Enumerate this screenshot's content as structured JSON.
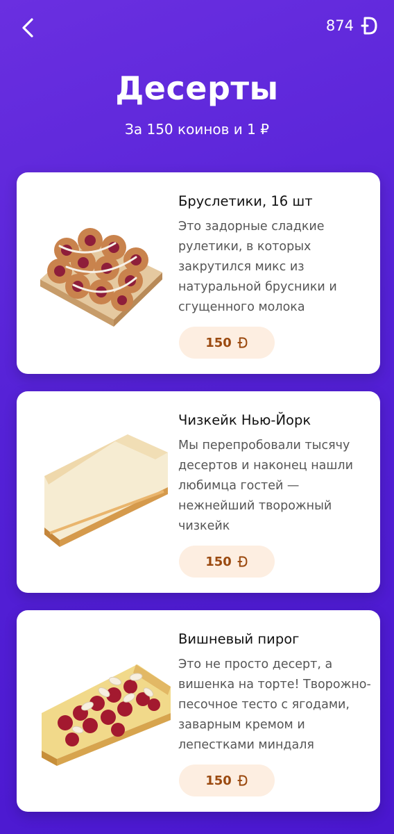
{
  "header": {
    "balance": "874"
  },
  "hero": {
    "title": "Десерты",
    "subtitle": "За 150 коинов и 1 ₽"
  },
  "colors": {
    "accent": "#5421d6",
    "price_bg": "#fdeee1",
    "price_text": "#9b4a10"
  },
  "items": [
    {
      "title": "Бруслетики, 16 шт",
      "description": "Это задорные сладкие рулетики, в которых закрутился микс из натуральной брусники и сгущенного молока",
      "price": "150",
      "icon": "coin-icon"
    },
    {
      "title": "Чизкейк Нью-Йорк",
      "description": "Мы перепробовали тысячу десертов и наконец нашли любимца гостей — нежнейший творожный чизкейк",
      "price": "150",
      "icon": "coin-icon"
    },
    {
      "title": "Вишневый пирог",
      "description": "Это не просто десерт, а вишенка на торте! Творожно-песочное тесто с ягодами, заварным кремом и лепестками миндаля",
      "price": "150",
      "icon": "coin-icon"
    }
  ]
}
